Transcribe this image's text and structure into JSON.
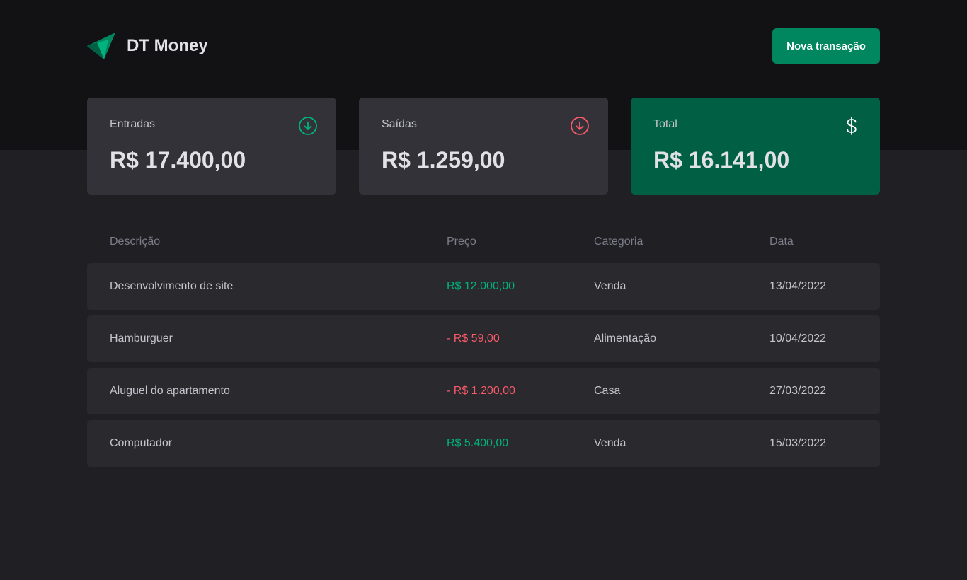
{
  "app": {
    "name": "DT Money",
    "new_transaction_label": "Nova transação"
  },
  "colors": {
    "accent": "#00875f",
    "income": "#00b37e",
    "outcome": "#f75a68",
    "total_card": "#015f43"
  },
  "summary": {
    "income": {
      "label": "Entradas",
      "value": "R$ 17.400,00",
      "icon": "arrow-circle-down-icon"
    },
    "outcome": {
      "label": "Saídas",
      "value": "R$ 1.259,00",
      "icon": "arrow-circle-down-icon"
    },
    "total": {
      "label": "Total",
      "value": "R$ 16.141,00",
      "icon": "dollar-icon"
    }
  },
  "table": {
    "columns": [
      "Descrição",
      "Preço",
      "Categoria",
      "Data"
    ],
    "rows": [
      {
        "description": "Desenvolvimento de site",
        "price": "R$ 12.000,00",
        "type": "income",
        "category": "Venda",
        "date": "13/04/2022"
      },
      {
        "description": "Hamburguer",
        "price": "- R$ 59,00",
        "type": "outcome",
        "category": "Alimentação",
        "date": "10/04/2022"
      },
      {
        "description": "Aluguel do apartamento",
        "price": "- R$ 1.200,00",
        "type": "outcome",
        "category": "Casa",
        "date": "27/03/2022"
      },
      {
        "description": "Computador",
        "price": "R$ 5.400,00",
        "type": "income",
        "category": "Venda",
        "date": "15/03/2022"
      }
    ]
  }
}
